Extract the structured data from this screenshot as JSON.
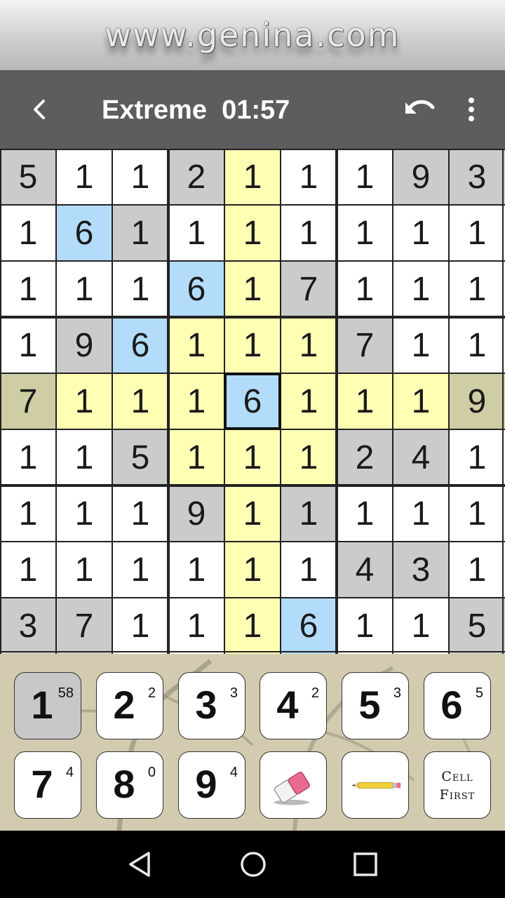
{
  "banner": {
    "text": "www.genina.com"
  },
  "toolbar": {
    "title": "Extreme  01:57",
    "back_icon": "chevron-left-icon",
    "undo_icon": "undo-icon",
    "menu_icon": "more-vert-icon"
  },
  "board": {
    "selected": [
      4,
      4
    ],
    "colors": {
      "given": "#cbcbcb",
      "empty": "#ffffff",
      "highlight": "#ffffb4",
      "given_in_highlight": "#cfcda3",
      "same_digit": "#b3dcfa",
      "grid": "#222222"
    },
    "rows": [
      [
        "5",
        "1",
        "1",
        "2",
        "1",
        "1",
        "1",
        "9",
        "3"
      ],
      [
        "1",
        "6",
        "1",
        "1",
        "1",
        "1",
        "1",
        "1",
        "1"
      ],
      [
        "1",
        "1",
        "1",
        "6",
        "1",
        "7",
        "1",
        "1",
        "1"
      ],
      [
        "1",
        "9",
        "6",
        "1",
        "1",
        "1",
        "7",
        "1",
        "1"
      ],
      [
        "7",
        "1",
        "1",
        "1",
        "6",
        "1",
        "1",
        "1",
        "9"
      ],
      [
        "1",
        "1",
        "5",
        "1",
        "1",
        "1",
        "2",
        "4",
        "1"
      ],
      [
        "1",
        "1",
        "1",
        "9",
        "1",
        "1",
        "1",
        "1",
        "1"
      ],
      [
        "1",
        "1",
        "1",
        "1",
        "1",
        "1",
        "4",
        "3",
        "1"
      ],
      [
        "3",
        "7",
        "1",
        "1",
        "1",
        "6",
        "1",
        "1",
        "5"
      ]
    ],
    "fill": [
      [
        "G",
        "W",
        "W",
        "G",
        "Y",
        "W",
        "W",
        "G",
        "G"
      ],
      [
        "W",
        "B",
        "G",
        "W",
        "Y",
        "W",
        "W",
        "W",
        "W"
      ],
      [
        "W",
        "W",
        "W",
        "B",
        "Y",
        "G",
        "W",
        "W",
        "W"
      ],
      [
        "W",
        "G",
        "B",
        "Y",
        "Y",
        "Y",
        "G",
        "W",
        "W"
      ],
      [
        "O",
        "Y",
        "Y",
        "Y",
        "B",
        "Y",
        "Y",
        "Y",
        "O"
      ],
      [
        "W",
        "W",
        "G",
        "Y",
        "Y",
        "Y",
        "G",
        "G",
        "W"
      ],
      [
        "W",
        "W",
        "W",
        "G",
        "Y",
        "G",
        "W",
        "W",
        "W"
      ],
      [
        "W",
        "W",
        "W",
        "W",
        "Y",
        "W",
        "G",
        "G",
        "W"
      ],
      [
        "G",
        "G",
        "W",
        "W",
        "Y",
        "B",
        "W",
        "W",
        "G"
      ]
    ]
  },
  "keypad": {
    "digits": [
      {
        "digit": "1",
        "count": "58",
        "selected": true
      },
      {
        "digit": "2",
        "count": "2"
      },
      {
        "digit": "3",
        "count": "3"
      },
      {
        "digit": "4",
        "count": "2"
      },
      {
        "digit": "5",
        "count": "3"
      },
      {
        "digit": "6",
        "count": "5"
      },
      {
        "digit": "7",
        "count": "4"
      },
      {
        "digit": "8",
        "count": "0"
      },
      {
        "digit": "9",
        "count": "4"
      }
    ],
    "eraser_icon": "eraser-icon",
    "pencil_icon": "pencil-icon",
    "cell_first_line1": "Cell",
    "cell_first_line2": "First"
  },
  "navbar": {
    "back_icon": "nav-back-icon",
    "home_icon": "nav-home-icon",
    "recents_icon": "nav-recents-icon"
  }
}
